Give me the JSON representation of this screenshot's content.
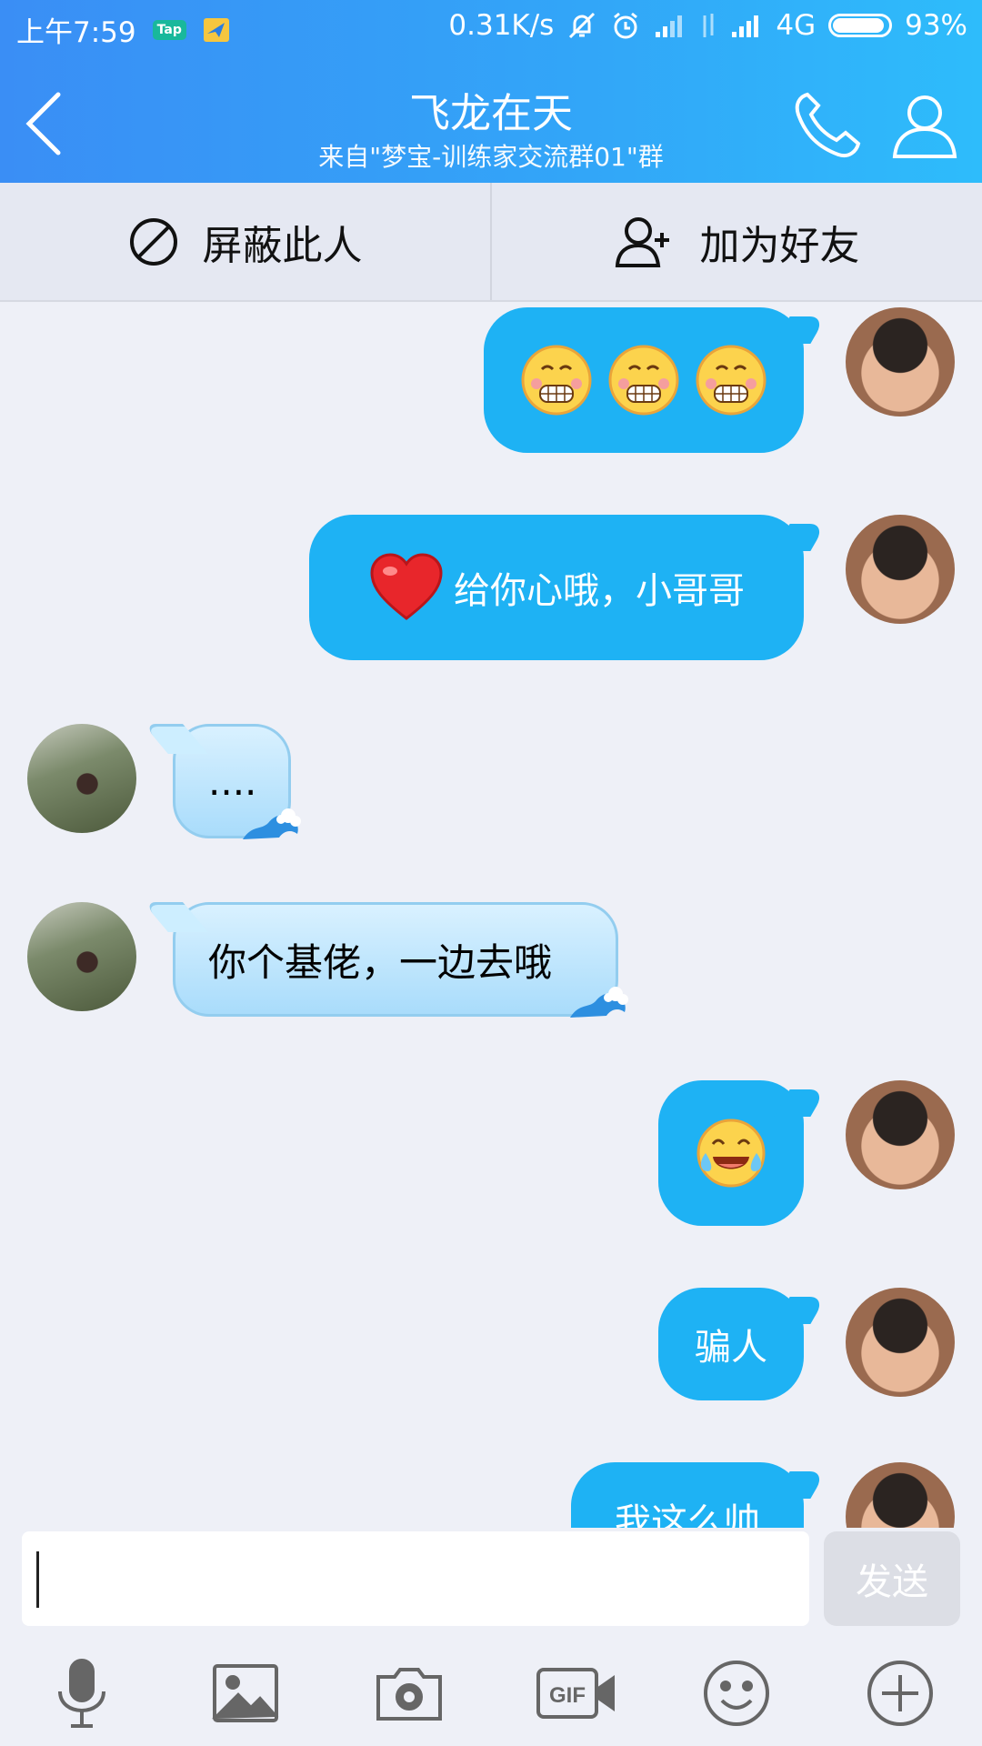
{
  "status_bar": {
    "time": "上午7:59",
    "tap_badge": "Tap",
    "network_speed": "0.31K/s",
    "network_type": "4G",
    "battery_percent": "93%",
    "battery_level": 0.93
  },
  "header": {
    "back_icon": "chevron-left-icon",
    "title": "飞龙在天",
    "subtitle": "来自\"梦宝-训练家交流群01\"群",
    "call_icon": "phone-icon",
    "profile_icon": "user-icon"
  },
  "actions": {
    "block_label": "屏蔽此人",
    "block_icon": "block-icon",
    "add_friend_label": "加为好友",
    "add_friend_icon": "add-user-icon"
  },
  "messages": [
    {
      "sender": "me",
      "type": "emoji",
      "emojis": [
        "grin",
        "grin",
        "grin"
      ]
    },
    {
      "sender": "me",
      "type": "text",
      "emoji": "heart",
      "text": "给你心哦，小哥哥"
    },
    {
      "sender": "other",
      "type": "text",
      "text": "...."
    },
    {
      "sender": "other",
      "type": "text",
      "text": "你个基佬，一边去哦"
    },
    {
      "sender": "me",
      "type": "emoji",
      "emojis": [
        "laugh-tears"
      ]
    },
    {
      "sender": "me",
      "type": "text",
      "text": "骗人"
    },
    {
      "sender": "me",
      "type": "text",
      "text": "我这么帅"
    }
  ],
  "input": {
    "value": "",
    "send_label": "发送"
  },
  "toolbar": [
    "microphone-icon",
    "image-icon",
    "camera-icon",
    "gif-icon",
    "smiley-icon",
    "plus-circle-icon"
  ],
  "colors": {
    "header_start": "#3a8ef5",
    "header_end": "#2ebcfb",
    "my_bubble": "#1eb2f4",
    "chat_background": "#eef0f7"
  }
}
